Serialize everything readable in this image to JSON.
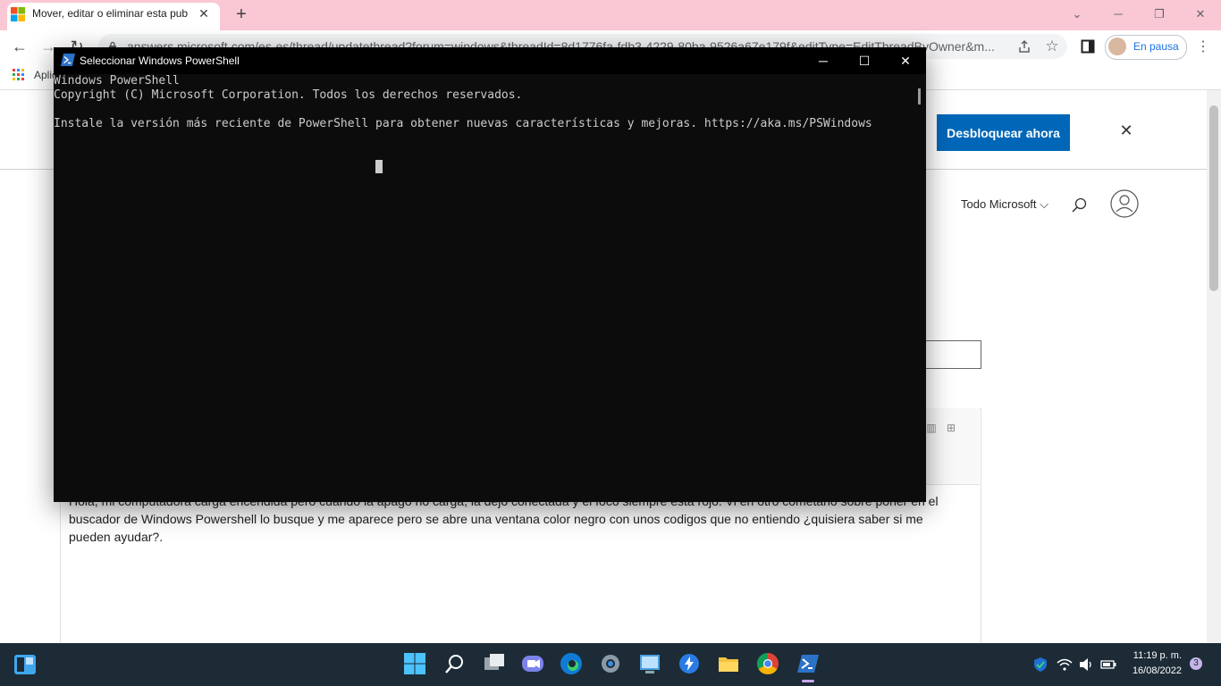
{
  "browser": {
    "tab_title": "Mover, editar o eliminar esta pub",
    "tab_close": "✕",
    "new_tab": "+",
    "url": "answers.microsoft.com/es-es/thread/updatethread?forum=windows&threadId=8d1776fa-fdb3-4229-80ba-9526a67e179f&editType=EditThreadByOwner&m...",
    "profile_status": "En pausa",
    "bookmark_apps": "Aplicaciones",
    "window_min": "─",
    "window_restore": "❐",
    "window_close": "✕",
    "back": "←",
    "forward": "→",
    "reload": "↻"
  },
  "page": {
    "unlock_button": "Desbloquear ahora",
    "banner_close": "✕",
    "all_microsoft": "Todo Microsoft",
    "post_text": "Hola, mi computadora carga encendida pero cuando la apago no carga, la dejo conectada y el foco siempre esta rojo. Vi en otro cometario sobre poner en el buscador de Windows Powershell lo busque y me aparece pero se abre una ventana color negro con unos codigos que no entiendo ¿quisiera saber si me pueden ayudar?."
  },
  "powershell": {
    "title": "Seleccionar Windows PowerShell",
    "minimize": "─",
    "maximize": "☐",
    "close": "✕",
    "output": "Windows PowerShell\nCopyright (C) Microsoft Corporation. Todos los derechos reservados.\n\nInstale la versión más reciente de PowerShell para obtener nuevas características y mejoras. https://aka.ms/PSWindows"
  },
  "taskbar": {
    "time": "11:19 p. m.",
    "date": "16/08/2022",
    "notifications": "3"
  },
  "colors": {
    "chrome_frame": "#f9c8d4",
    "ms_blue": "#0067b8",
    "terminal_bg": "#0c0c0c",
    "taskbar_bg": "#1c2b36"
  }
}
